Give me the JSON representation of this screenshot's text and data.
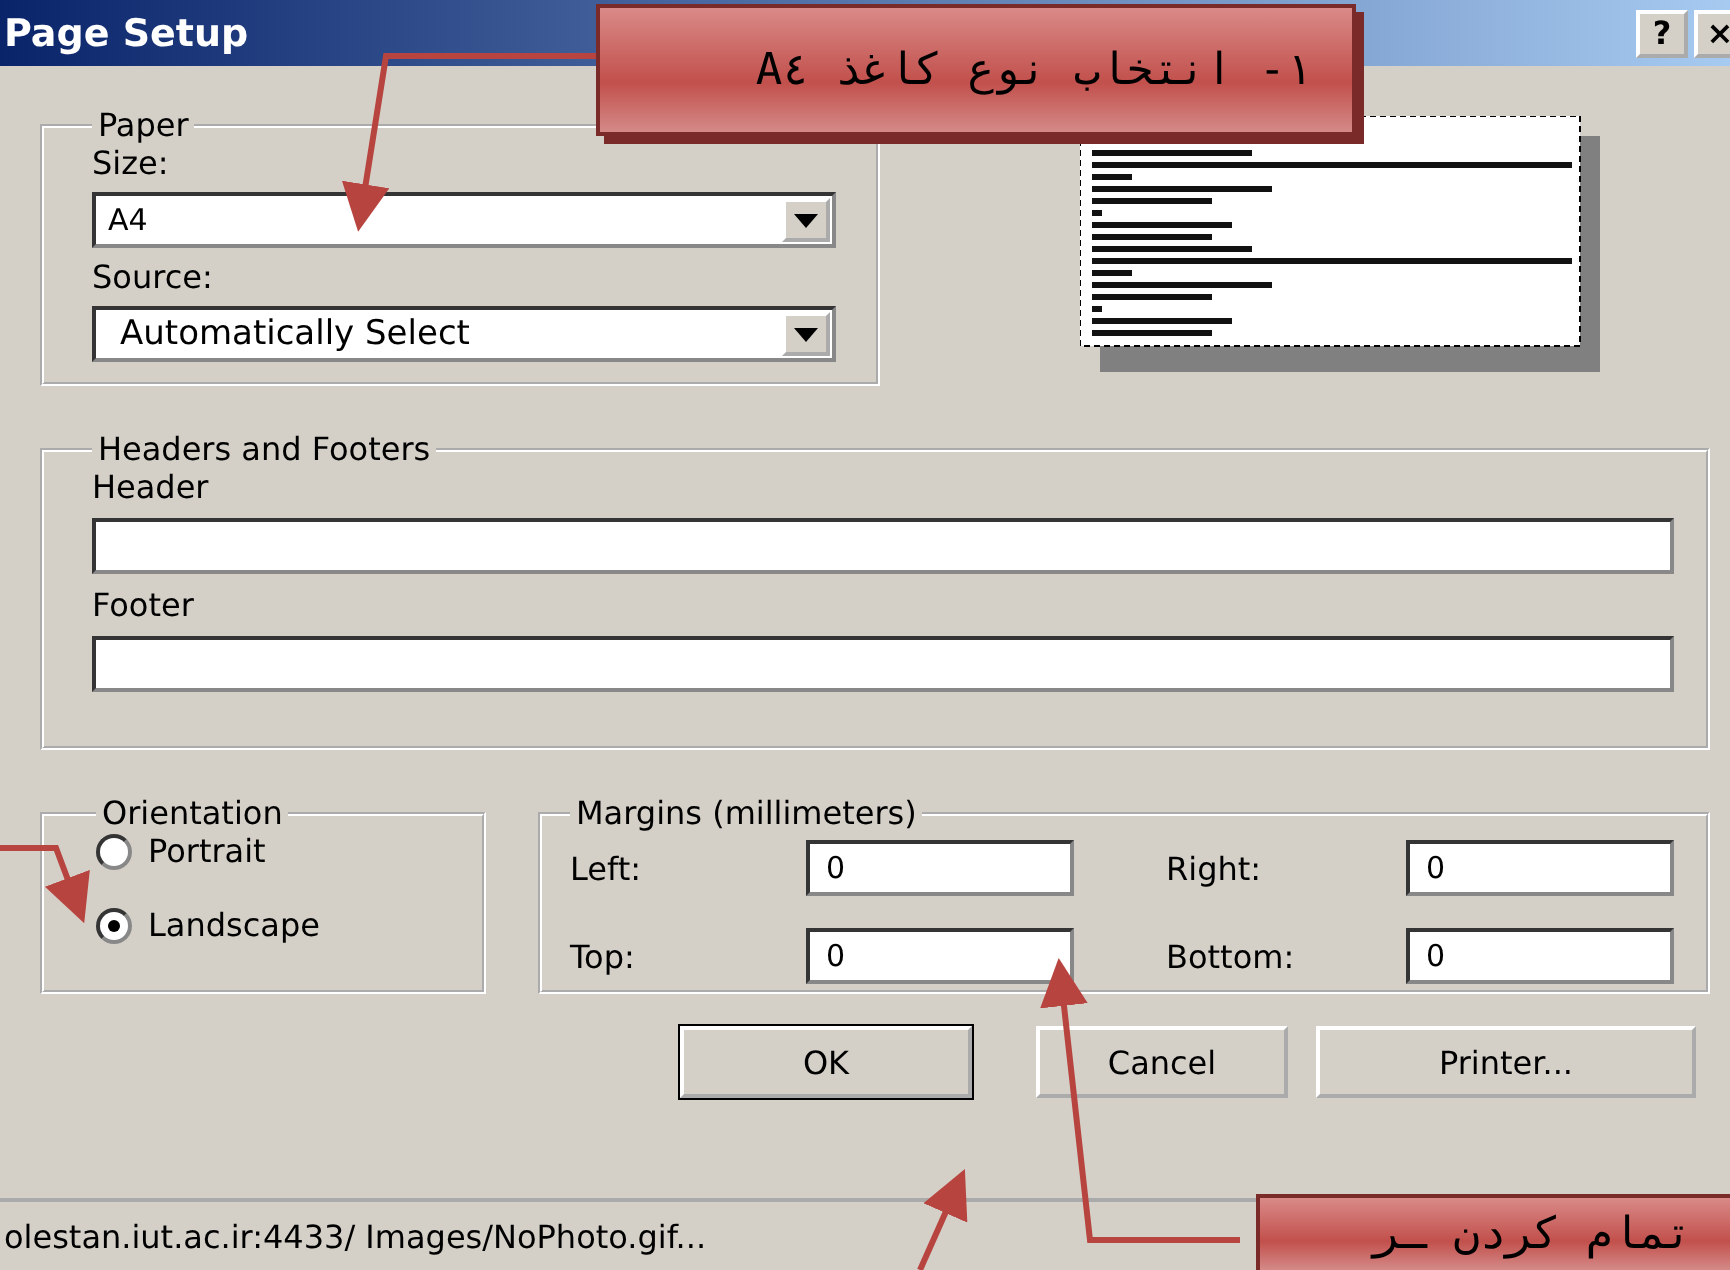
{
  "window": {
    "title": "Page Setup",
    "buttons": [
      "?",
      "×"
    ]
  },
  "paper": {
    "title": "Paper",
    "size_label": "Size:",
    "size_value": "A4",
    "source_label": "Source:",
    "source_value": "Automatically Select"
  },
  "headers_footers": {
    "title": "Headers and Footers",
    "header_label": "Header",
    "footer_label": "Footer"
  },
  "orientation": {
    "title": "Orientation",
    "options": [
      {
        "label": "Portrait",
        "selected": false
      },
      {
        "label": "Landscape",
        "selected": true
      }
    ]
  },
  "margins": {
    "title": "Margins (millimeters)",
    "fields": [
      {
        "label": "Left:",
        "value": "0"
      },
      {
        "label": "Right:",
        "value": "0"
      },
      {
        "label": "Top:",
        "value": "0"
      },
      {
        "label": "Bottom:",
        "value": "0"
      }
    ]
  },
  "buttons": [
    "OK",
    "Cancel",
    "Printer..."
  ],
  "status_bar": {
    "text": "olestan.iut.ac.ir:4433/ Images/NoPhoto.gif..."
  },
  "callouts": [
    {
      "text": "١- انتخاب نوع کاغذ A٤"
    },
    {
      "text": "تمام کردن ـر"
    }
  ]
}
